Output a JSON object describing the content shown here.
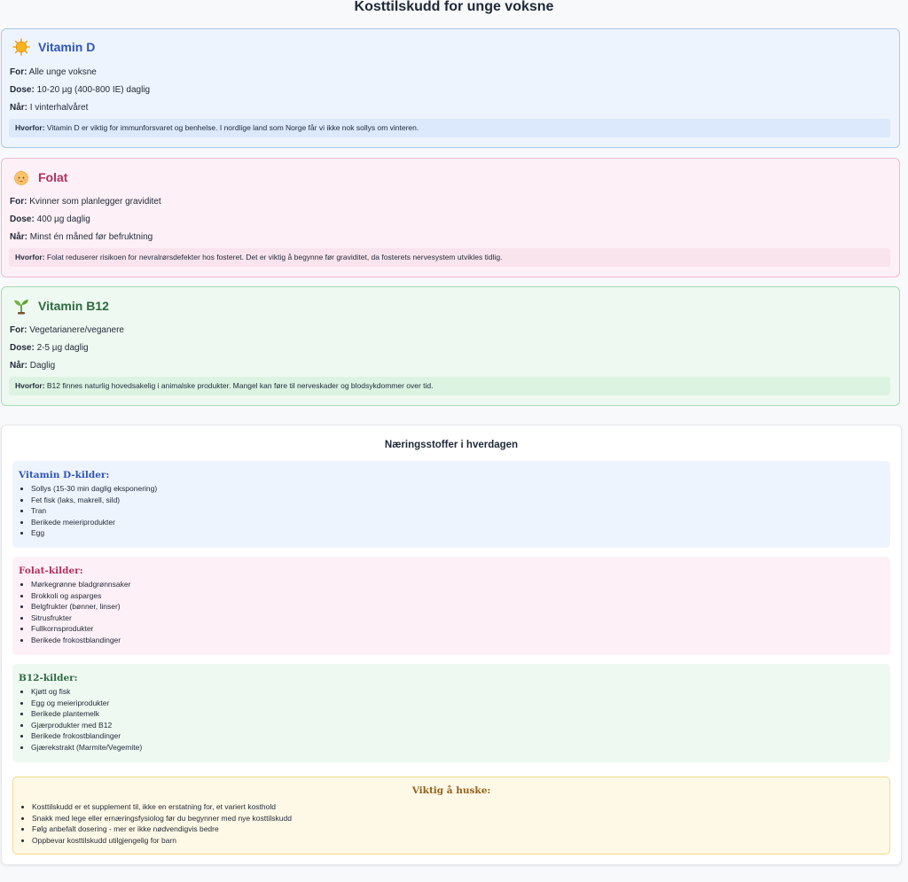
{
  "title": "Kosttilskudd for unge voksne",
  "supplements": {
    "vitamin_d": {
      "icon": "sun-icon",
      "name": "Vitamin D",
      "for_label": "For:",
      "for_value": " Alle unge voksne",
      "dose_label": "Dose:",
      "dose_value": " 10-20 µg (400-800 IE) daglig",
      "when_label": "Når:",
      "when_value": " I vinterhalvåret",
      "why_label": "Hvorfor:",
      "why_value": " Vitamin D er viktig for immunforsvaret og benhelse. I nordlige land som Norge får vi ikke nok sollys om vinteren.",
      "accent": "#2f56b8"
    },
    "folat": {
      "icon": "baby-icon",
      "name": "Folat",
      "for_label": "For:",
      "for_value": " Kvinner som planlegger graviditet",
      "dose_label": "Dose:",
      "dose_value": " 400 µg daglig",
      "when_label": "Når:",
      "when_value": " Minst én måned før befruktning",
      "why_label": "Hvorfor:",
      "why_value": " Folat reduserer risikoen for nevralrørsdefekter hos fosteret. Det er viktig å begynne før graviditet, da fosterets nervesystem utvikles tidlig.",
      "accent": "#b0325d"
    },
    "b12": {
      "icon": "seedling-icon",
      "name": "Vitamin B12",
      "for_label": "For:",
      "for_value": " Vegetarianere/veganere",
      "dose_label": "Dose:",
      "dose_value": " 2-5 µg daglig",
      "when_label": "Når:",
      "when_value": " Daglig",
      "why_label": "Hvorfor:",
      "why_value": " B12 finnes naturlig hovedsakelig i animalske produkter. Mangel kan føre til nerveskader og blodsykdommer over tid.",
      "accent": "#2d6a3f"
    }
  },
  "daily": {
    "title": "Næringsstoffer i hverdagen",
    "vitamin_d_sources": {
      "title": "Vitamin D-kilder:",
      "items": [
        "Sollys (15-30 min daglig eksponering)",
        "Fet fisk (laks, makrell, sild)",
        "Tran",
        "Berikede meieriprodukter",
        "Egg"
      ]
    },
    "folat_sources": {
      "title": "Folat-kilder:",
      "items": [
        "Mørkegrønne bladgrønnsaker",
        "Brokkoli og asparges",
        "Belgfrukter (bønner, linser)",
        "Sitrusfrukter",
        "Fullkornsprodukter",
        "Berikede frokostblandinger"
      ]
    },
    "b12_sources": {
      "title": "B12-kilder:",
      "items": [
        "Kjøtt og fisk",
        "Egg og meieriprodukter",
        "Berikede plantemelk",
        "Gjærprodukter med B12",
        "Berikede frokostblandinger",
        "Gjærekstrakt (Marmite/Vegemite)"
      ]
    },
    "remember": {
      "title": "Viktig å huske:",
      "items": [
        "Kosttilskudd er et supplement til, ikke en erstatning for, et variert kosthold",
        "Snakk med lege eller ernæringsfysiolog før du begynner med nye kosttilskudd",
        "Følg anbefalt dosering - mer er ikke nødvendigvis bedre",
        "Oppbevar kosttilskudd utilgjengelig for barn"
      ]
    }
  }
}
